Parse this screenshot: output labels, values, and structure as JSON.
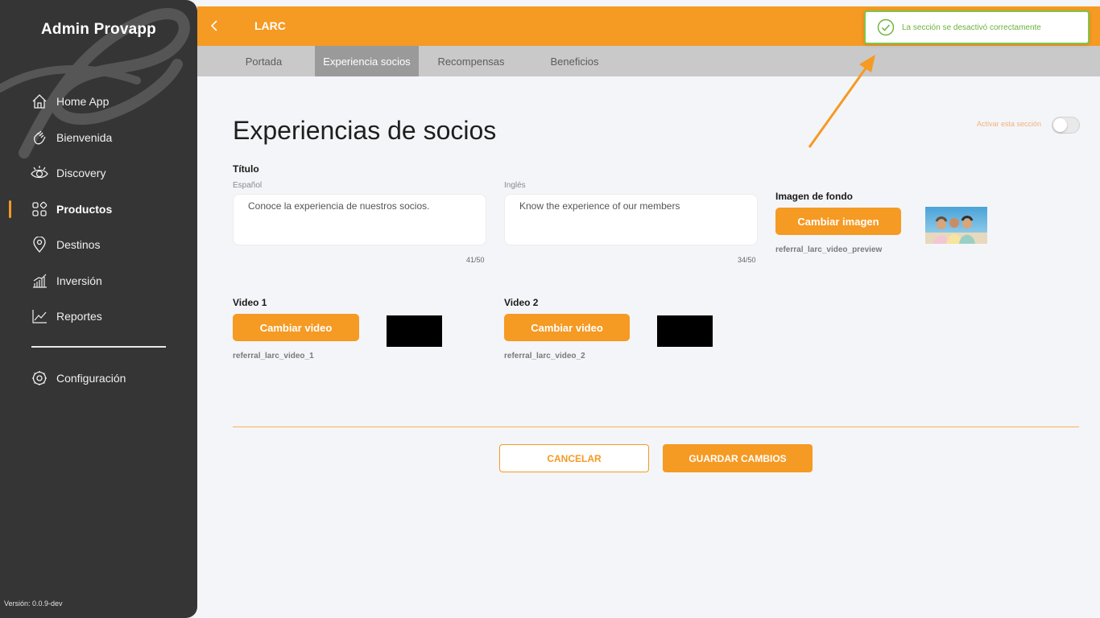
{
  "app": {
    "title": "Admin Provapp",
    "version": "Versión: 0.0.9-dev"
  },
  "sidebar": {
    "items": [
      {
        "label": "Home App",
        "icon": "home-icon"
      },
      {
        "label": "Bienvenida",
        "icon": "wave-hand-icon"
      },
      {
        "label": "Discovery",
        "icon": "eye-icon"
      },
      {
        "label": "Productos",
        "icon": "grid-icon",
        "active": true
      },
      {
        "label": "Destinos",
        "icon": "location-pin-icon"
      },
      {
        "label": "Inversión",
        "icon": "bar-chart-icon"
      },
      {
        "label": "Reportes",
        "icon": "line-chart-icon"
      },
      {
        "label": "Configuración",
        "icon": "gear-icon"
      }
    ]
  },
  "header": {
    "title": "LARC",
    "back_icon": "chevron-left-icon"
  },
  "tabs": [
    {
      "label": "Portada"
    },
    {
      "label": "Experiencia socios",
      "active": true
    },
    {
      "label": "Recompensas"
    },
    {
      "label": "Beneficios"
    }
  ],
  "toast": {
    "message": "La sección se desactivó correctamente",
    "icon": "check-circle-icon",
    "color": "#7ec64a"
  },
  "main": {
    "title": "Experiencias de socios",
    "toggle": {
      "label": "Activar esta sección",
      "enabled": false
    },
    "titulo": {
      "label": "Título",
      "spanish": {
        "label": "Español",
        "value": "Conoce la experiencia de nuestros socios.",
        "counter": "41/50"
      },
      "english": {
        "label": "Inglés",
        "value": "Know the experience of our members",
        "counter": "34/50"
      }
    },
    "background_image": {
      "label": "Imagen de fondo",
      "button": "Cambiar imagen",
      "file": "referral_larc_video_preview"
    },
    "video1": {
      "label": "Video 1",
      "button": "Cambiar video",
      "file": "referral_larc_video_1"
    },
    "video2": {
      "label": "Video 2",
      "button": "Cambiar video",
      "file": "referral_larc_video_2"
    },
    "actions": {
      "cancel": "CANCELAR",
      "save": "GUARDAR CAMBIOS"
    }
  },
  "colors": {
    "accent": "#f59a23",
    "sidebar": "#353535",
    "success": "#7ec64a"
  }
}
